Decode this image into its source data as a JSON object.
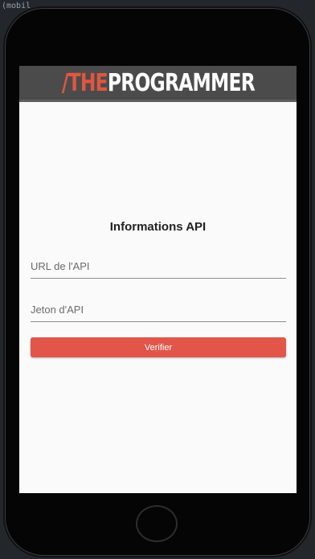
{
  "editor": {
    "hint": "(mobil"
  },
  "app": {
    "logo_accent": "/THE",
    "logo_rest": "PROGRAMMER",
    "accent_color": "#e0563f",
    "appbar_color": "#4b4b4b"
  },
  "form": {
    "title": "Informations API",
    "url_placeholder": "URL de l'API",
    "url_value": "",
    "token_placeholder": "Jeton d'API",
    "token_value": "",
    "verify_label": "Verifier",
    "button_color": "#e2564a"
  }
}
